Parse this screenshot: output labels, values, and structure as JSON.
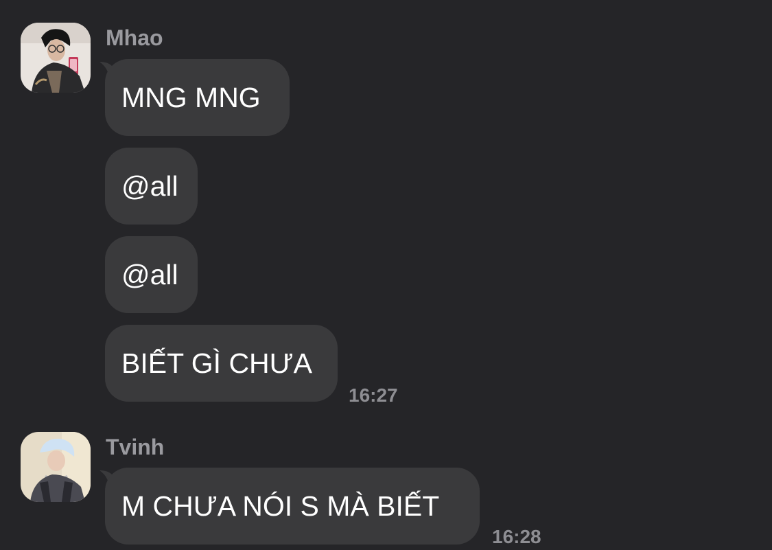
{
  "colors": {
    "background": "#252528",
    "bubble": "#3a3a3c",
    "message_text": "#ffffff",
    "meta_text": "#8e8e93"
  },
  "messages": [
    {
      "sender": "Mhao",
      "avatar_icon": "user-avatar-icon",
      "bubbles": [
        "MNG MNG",
        "@all",
        "@all",
        "BIẾT GÌ CHƯA"
      ],
      "time": "16:27"
    },
    {
      "sender": "Tvinh",
      "avatar_icon": "user-avatar-icon",
      "bubbles": [
        "M CHƯA NÓI S MÀ BIẾT"
      ],
      "time": "16:28"
    }
  ]
}
